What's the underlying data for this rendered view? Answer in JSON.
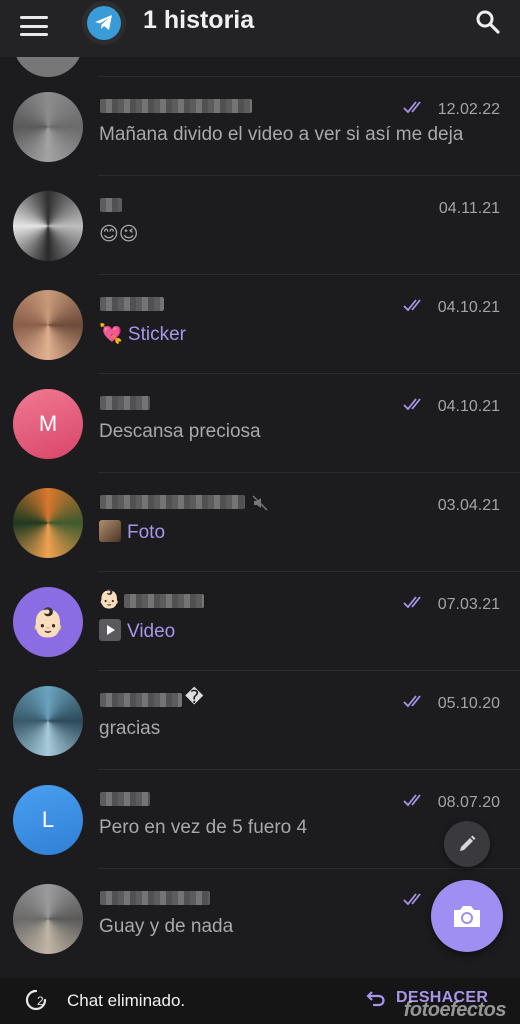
{
  "app_bar": {
    "title": "1 historia",
    "menu_icon": "hamburger-menu-icon",
    "logo_icon": "telegram-logo-icon",
    "search_icon": "search-icon"
  },
  "chats": [
    {
      "name_hidden": true,
      "date": "12.02.22",
      "read": true,
      "message": "Mañana divido el video a ver si así me deja",
      "avatar_letter": "",
      "avatar_color": "#8a8a8a"
    },
    {
      "name_hidden": true,
      "date": "04.11.21",
      "read": false,
      "message": "😊😉",
      "avatar_letter": "",
      "avatar_color": "#444"
    },
    {
      "name_hidden": true,
      "date": "04.10.21",
      "read": true,
      "message": "💘 Sticker",
      "accent": true,
      "avatar_letter": "",
      "avatar_color": "#a07060"
    },
    {
      "name_hidden": true,
      "date": "04.10.21",
      "read": true,
      "message": "Descansa preciosa",
      "avatar_letter": "M",
      "avatar_color": "#e45c78"
    },
    {
      "name_hidden": true,
      "muted": true,
      "date": "03.04.21",
      "read": false,
      "message": "Foto",
      "accent": true,
      "thumb": true,
      "avatar_letter": "",
      "avatar_color": "#c06a2a"
    },
    {
      "name_hidden": true,
      "date": "07.03.21",
      "read": true,
      "message": "Video",
      "accent": true,
      "video": true,
      "avatar_letter": "👶🏻",
      "avatar_color": "#8a6de3"
    },
    {
      "name_hidden": true,
      "date": "05.10.20",
      "read": true,
      "message": "gracias",
      "avatar_letter": "",
      "avatar_color": "#5a8fa8"
    },
    {
      "name_hidden": true,
      "date": "08.07.20",
      "read": true,
      "message": "Pero en vez de 5 fuero  4",
      "avatar_letter": "L",
      "avatar_color": "#3d8ee6"
    },
    {
      "name_hidden": true,
      "date": "",
      "read": true,
      "message": "Guay y de nada",
      "avatar_letter": "",
      "avatar_color": "#7a7a7a"
    }
  ],
  "fab": {
    "edit_icon": "pencil-icon",
    "camera_icon": "camera-icon"
  },
  "snackbar": {
    "counter": "2",
    "text": "Chat eliminado.",
    "undo_label": "DESHACER",
    "undo_icon": "undo-icon"
  },
  "watermark": "fotoefectos",
  "colors": {
    "accent": "#a995ea",
    "fab": "#9f8ff2",
    "background": "#1c1c1e"
  }
}
